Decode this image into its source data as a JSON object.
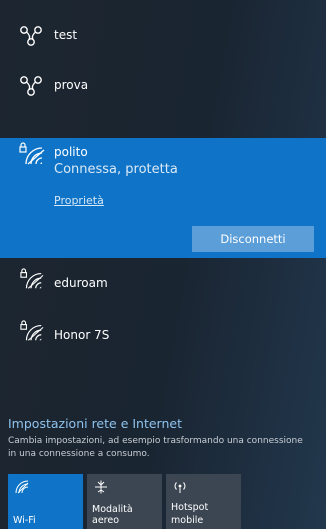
{
  "networks": {
    "top": [
      {
        "name": "test",
        "icon": "mobile-hotspot-icon"
      },
      {
        "name": "prova",
        "icon": "mobile-hotspot-icon"
      }
    ],
    "selected": {
      "name": "polito",
      "status": "Connessa, protetta",
      "properties_link": "Proprietà",
      "disconnect_label": "Disconnetti",
      "icon": "secured-wifi-icon"
    },
    "bottom": [
      {
        "name": "eduroam",
        "icon": "secured-wifi-icon"
      },
      {
        "name": "Honor 7S",
        "icon": "secured-wifi-icon"
      }
    ]
  },
  "settings": {
    "title": "Impostazioni rete e Internet",
    "description": "Cambia impostazioni, ad esempio trasformando una connessione in una connessione a consumo."
  },
  "quick_actions": {
    "wifi": {
      "label": "Wi-Fi",
      "icon": "wifi-icon",
      "active": true
    },
    "airplane": {
      "label": "Modalità aereo",
      "icon": "airplane-icon",
      "active": false
    },
    "hotspot": {
      "label_line1": "Hotspot",
      "label_line2": "mobile",
      "icon": "hotspot-icon",
      "active": false
    }
  },
  "colors": {
    "accent": "#0f74c7",
    "disconnect_button": "#5b9ed8",
    "settings_link": "#8fc3ee",
    "tile_inactive": "#3b4652"
  }
}
